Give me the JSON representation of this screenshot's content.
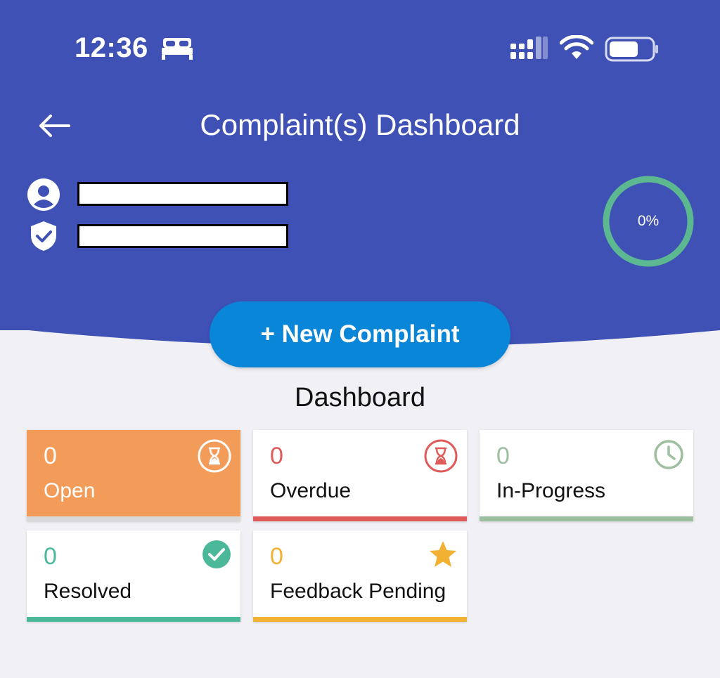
{
  "status_bar": {
    "time": "12:36"
  },
  "header": {
    "title": "Complaint(s) Dashboard"
  },
  "progress": {
    "label": "0%",
    "value": 0
  },
  "new_complaint_label": "+ New Complaint",
  "section_title": "Dashboard",
  "cards": [
    {
      "count": "0",
      "label": "Open",
      "icon": "hourglass-icon"
    },
    {
      "count": "0",
      "label": "Overdue",
      "icon": "hourglass-icon"
    },
    {
      "count": "0",
      "label": "In-Progress",
      "icon": "clock-icon"
    },
    {
      "count": "0",
      "label": "Resolved",
      "icon": "check-circle-icon"
    },
    {
      "count": "0",
      "label": "Feedback Pending",
      "icon": "star-icon"
    }
  ],
  "colors": {
    "header": "#3f51b5",
    "open": "#f39c5a",
    "overdue": "#e05a5a",
    "in_progress": "#9dbf9f",
    "resolved": "#4cb89a",
    "feedback": "#f2b132",
    "button": "#0a86d9",
    "ring": "#5cb891"
  }
}
